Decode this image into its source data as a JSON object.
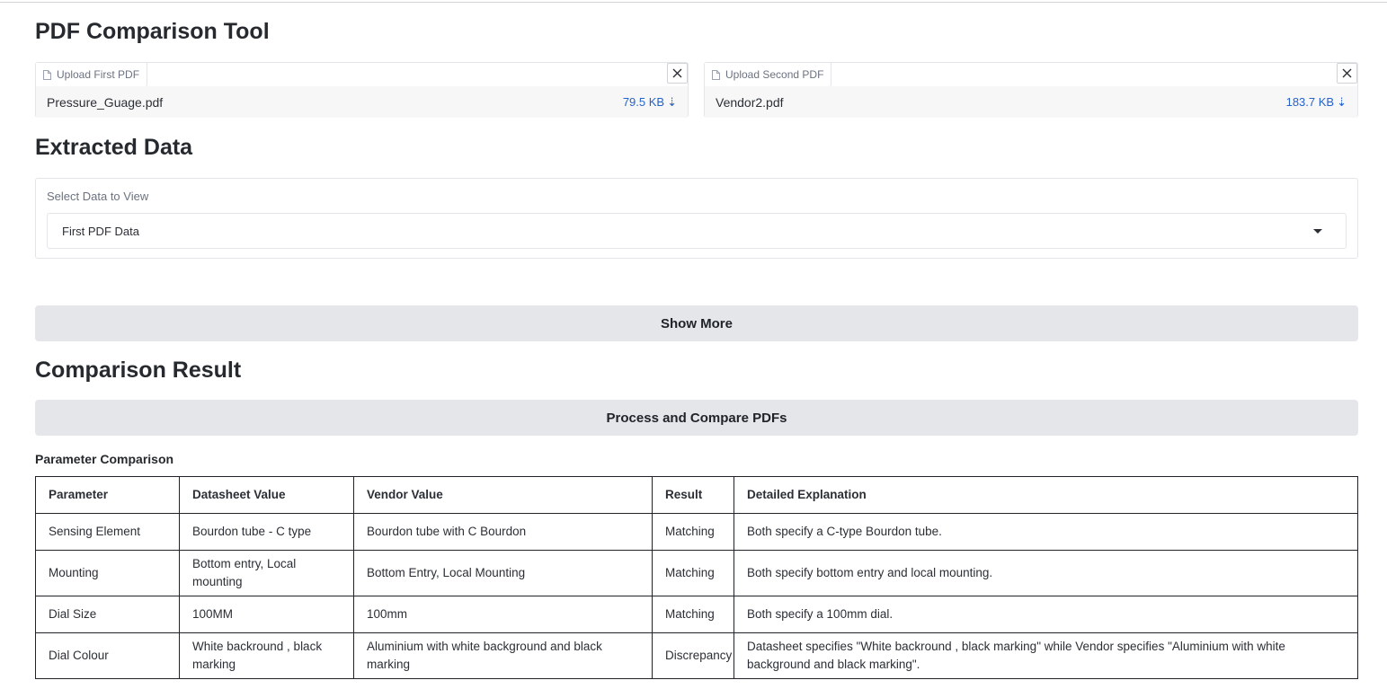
{
  "title": "PDF Comparison Tool",
  "uploads": [
    {
      "label": "Upload First PDF",
      "file_name": "Pressure_Guage.pdf",
      "file_size": "79.5 KB"
    },
    {
      "label": "Upload Second PDF",
      "file_name": "Vendor2.pdf",
      "file_size": "183.7 KB"
    }
  ],
  "extracted": {
    "heading": "Extracted Data",
    "select_label": "Select Data to View",
    "selected_option": "First PDF Data",
    "show_more_label": "Show More"
  },
  "comparison": {
    "heading": "Comparison Result",
    "process_button_label": "Process and Compare PDFs",
    "table_title": "Parameter Comparison",
    "columns": [
      "Parameter",
      "Datasheet Value",
      "Vendor Value",
      "Result",
      "Detailed Explanation"
    ],
    "rows": [
      [
        "Sensing Element",
        "Bourdon tube - C type",
        "Bourdon tube with C Bourdon",
        "Matching",
        "Both specify a C-type Bourdon tube."
      ],
      [
        "Mounting",
        "Bottom entry, Local mounting",
        "Bottom Entry, Local Mounting",
        "Matching",
        "Both specify bottom entry and local mounting."
      ],
      [
        "Dial Size",
        "100MM",
        "100mm",
        "Matching",
        "Both specify a 100mm dial."
      ],
      [
        "Dial Colour",
        "White backround , black marking",
        "Aluminium with white background and black marking",
        "Discrepancy",
        "Datasheet specifies \"White backround , black marking\" while Vendor specifies \"Aluminium with white background and black marking\"."
      ]
    ]
  },
  "icons": {
    "file": "file-icon",
    "close": "close-icon",
    "download": "download-arrow-icon",
    "caret": "chevron-down-icon"
  },
  "colors": {
    "link": "#2563c9",
    "button_bg": "#e5e6e9",
    "border": "#e3e5e8"
  }
}
